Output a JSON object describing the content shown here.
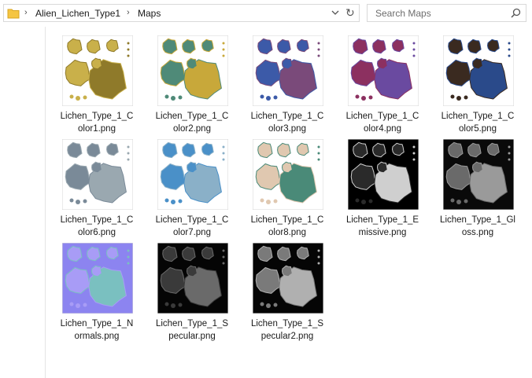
{
  "address": {
    "breadcrumb": [
      "Alien_Lichen_Type1",
      "Maps"
    ]
  },
  "search": {
    "placeholder": "Search Maps"
  },
  "files": [
    {
      "name": "Lichen_Type_1_Color1.png",
      "line1": "Lichen_Type_1_C",
      "line2": "olor1.png",
      "icon": "image-thumbnail",
      "bg": "#ffffff",
      "c1": "#c9b04a",
      "c2": "#8f7a2a"
    },
    {
      "name": "Lichen_Type_1_Color2.png",
      "line1": "Lichen_Type_1_C",
      "line2": "olor2.png",
      "icon": "image-thumbnail",
      "bg": "#ffffff",
      "c1": "#4f8a78",
      "c2": "#c8a83a"
    },
    {
      "name": "Lichen_Type_1_Color3.png",
      "line1": "Lichen_Type_1_C",
      "line2": "olor3.png",
      "icon": "image-thumbnail",
      "bg": "#ffffff",
      "c1": "#3c5aa8",
      "c2": "#7a4a7a"
    },
    {
      "name": "Lichen_Type_1_Color4.png",
      "line1": "Lichen_Type_1_C",
      "line2": "olor4.png",
      "icon": "image-thumbnail",
      "bg": "#ffffff",
      "c1": "#8c3060",
      "c2": "#6a4aa0"
    },
    {
      "name": "Lichen_Type_1_Color5.png",
      "line1": "Lichen_Type_1_C",
      "line2": "olor5.png",
      "icon": "image-thumbnail",
      "bg": "#ffffff",
      "c1": "#3a2a20",
      "c2": "#2a4a8a"
    },
    {
      "name": "Lichen_Type_1_Color6.png",
      "line1": "Lichen_Type_1_C",
      "line2": "olor6.png",
      "icon": "image-thumbnail",
      "bg": "#ffffff",
      "c1": "#7a8a98",
      "c2": "#9aa8b0"
    },
    {
      "name": "Lichen_Type_1_Color7.png",
      "line1": "Lichen_Type_1_C",
      "line2": "olor7.png",
      "icon": "image-thumbnail",
      "bg": "#ffffff",
      "c1": "#4a90c8",
      "c2": "#8ab0c8"
    },
    {
      "name": "Lichen_Type_1_Color8.png",
      "line1": "Lichen_Type_1_C",
      "line2": "olor8.png",
      "icon": "image-thumbnail",
      "bg": "#ffffff",
      "c1": "#e0c8b0",
      "c2": "#4a8a78"
    },
    {
      "name": "Lichen_Type_1_Emissive.png",
      "line1": "Lichen_Type_1_E",
      "line2": "missive.png",
      "icon": "image-thumbnail",
      "bg": "#000000",
      "c1": "#2a2a2a",
      "c2": "#cfcfcf"
    },
    {
      "name": "Lichen_Type_1_Gloss.png",
      "line1": "Lichen_Type_1_Gl",
      "line2": "oss.png",
      "icon": "image-thumbnail",
      "bg": "#0a0a0a",
      "c1": "#6a6a6a",
      "c2": "#9a9a9a"
    },
    {
      "name": "Lichen_Type_1_Normals.png",
      "line1": "Lichen_Type_1_N",
      "line2": "ormals.png",
      "icon": "image-thumbnail",
      "bg": "#8c84f0",
      "c1": "#a89cf6",
      "c2": "#7ac0c0"
    },
    {
      "name": "Lichen_Type_1_Specular.png",
      "line1": "Lichen_Type_1_S",
      "line2": "pecular.png",
      "icon": "image-thumbnail",
      "bg": "#050505",
      "c1": "#3a3a3a",
      "c2": "#6a6a6a"
    },
    {
      "name": "Lichen_Type_1_Specular2.png",
      "line1": "Lichen_Type_1_S",
      "line2": "pecular2.png",
      "icon": "image-thumbnail",
      "bg": "#050505",
      "c1": "#7a7a7a",
      "c2": "#b0b0b0"
    }
  ]
}
